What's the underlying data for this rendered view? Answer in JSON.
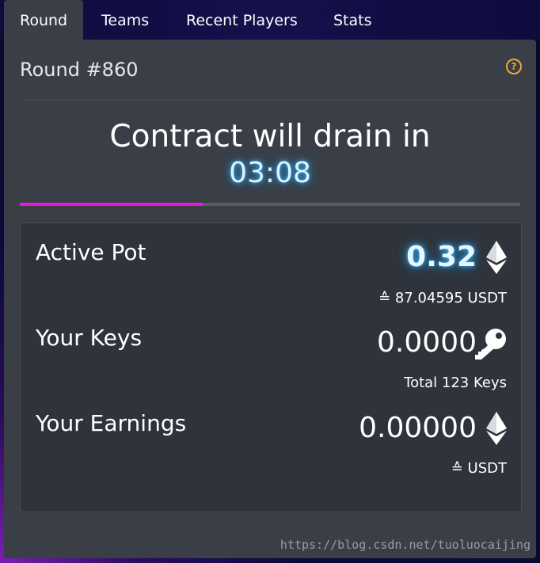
{
  "tabs": [
    {
      "label": "Round",
      "active": true
    },
    {
      "label": "Teams",
      "active": false
    },
    {
      "label": "Recent Players",
      "active": false
    },
    {
      "label": "Stats",
      "active": false
    }
  ],
  "round": {
    "title": "Round #860",
    "help_icon": "question-circle-icon",
    "drain_label": "Contract will drain in",
    "timer": "03:08",
    "progress_fraction": 0.365,
    "progress_color": "#e21bdc"
  },
  "stats": {
    "active_pot": {
      "label": "Active Pot",
      "value": "0.32",
      "icon": "ethereum-icon",
      "sub": "≙ 87.04595 USDT"
    },
    "your_keys": {
      "label": "Your Keys",
      "value": "0.0000",
      "icon": "key-icon",
      "sub": "Total 123 Keys"
    },
    "your_earnings": {
      "label": "Your Earnings",
      "value": "0.00000",
      "icon": "ethereum-icon",
      "sub": "≙ USDT"
    }
  },
  "watermark": "https://blog.csdn.net/tuoluocaijing",
  "colors": {
    "panel": "#3a3e46",
    "box": "#2f333b",
    "accent_timer": "#3ab7ff",
    "help_icon": "#e9a93a"
  }
}
